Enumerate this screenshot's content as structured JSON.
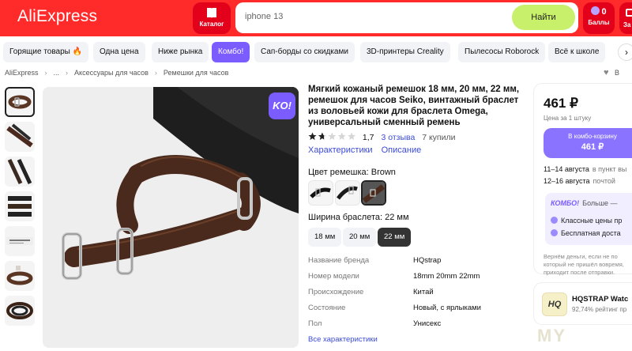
{
  "header": {
    "logo": "AliExpress",
    "catalog_label": "Каталог",
    "search_value": "iphone 13",
    "find_button": "Найти",
    "points_count": "0",
    "points_label": "Баллы",
    "edge_label": "За"
  },
  "chips": [
    {
      "label": "Горящие товары 🔥"
    },
    {
      "label": "Одна цена"
    },
    {
      "label": "Ниже рынка"
    },
    {
      "label": "Комбо!"
    },
    {
      "label": "Сап-борды со скидками"
    },
    {
      "label": "3D-принтеры Creality"
    },
    {
      "label": "Пылесосы Roborock"
    },
    {
      "label": "Всё к школе"
    }
  ],
  "chips_next": "›",
  "breadcrumb": {
    "items": [
      "AliExpress",
      "...",
      "Аксессуары для часов",
      "Ремешки для часов"
    ],
    "separator": "›",
    "favorite_label": "В"
  },
  "product": {
    "title": "Мягкий кожаный ремешок 18 мм, 20 мм, 22 мм, ремешок для часов Seiko, винтажный браслет из воловьей кожи для браслета Omega, универсальный сменный ремень",
    "rating": "1,7",
    "stars_value": 1.7,
    "reviews": "3 отзыва",
    "sold": "7 купили",
    "tabs": [
      "Характеристики",
      "Описание"
    ],
    "color_label": "Цвет ремешка: Brown",
    "width_label": "Ширина браслета: 22 мм",
    "sizes": [
      "18 мм",
      "20 мм",
      "22 мм"
    ],
    "badge": "KO!",
    "specs": [
      {
        "name": "Название бренда",
        "value": "HQstrap"
      },
      {
        "name": "Номер модели",
        "value": "18mm 20mm 22mm"
      },
      {
        "name": "Происхождение",
        "value": "Китай"
      },
      {
        "name": "Состояние",
        "value": "Новый, с ярлыками"
      },
      {
        "name": "Пол",
        "value": "Унисекс"
      }
    ],
    "all_specs_link": "Все характеристики"
  },
  "buy": {
    "price": "461 ₽",
    "price_note": "Цена за 1 штуку",
    "combo_label": "В комбо-корзину",
    "combo_price": "461 ₽",
    "delivery": [
      {
        "date": "11–14 августа",
        "note": "в пункт вы"
      },
      {
        "date": "12–16 августа",
        "note": "почтой"
      }
    ],
    "promo_brand": "КОМБО!",
    "promo_more": "Больше —",
    "promo_items": [
      "Классные цены пр",
      "Бесплатная доста"
    ],
    "refund_note": "Вернём деньги, если не по который не пришёл вовремя, приходит после отправки."
  },
  "store": {
    "logo": "HQ",
    "name": "HQSTRAP Watc",
    "rating": "92,74% рейтинг пр"
  },
  "watermark": "MY",
  "colors": {
    "header_red": "#ff2a2a",
    "accent_purple": "#7a5cff",
    "find_green": "#c8f06a",
    "link_blue": "#3b4bd6"
  }
}
